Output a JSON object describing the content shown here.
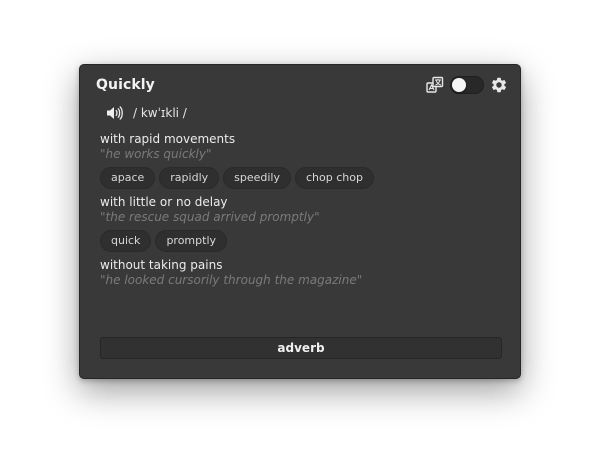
{
  "window": {
    "title": "Quickly"
  },
  "pronunciation": "/ kwˈɪkli /",
  "senses": [
    {
      "definition": "with rapid movements",
      "example": "\"he works quickly\"",
      "synonyms": [
        "apace",
        "rapidly",
        "speedily",
        "chop chop"
      ]
    },
    {
      "definition": "with little or no delay",
      "example": "\"the rescue squad arrived promptly\"",
      "synonyms": [
        "quick",
        "promptly"
      ]
    },
    {
      "definition": "without taking pains",
      "example": "\"he looked cursorily through the magazine\"",
      "synonyms": []
    }
  ],
  "part_of_speech": "adverb",
  "toggle": {
    "on": false
  },
  "icons": {
    "translate": "translate-icon",
    "toggle": "toggle-switch",
    "settings": "gear-icon",
    "speaker": "speaker-icon"
  },
  "colors": {
    "window_bg": "#393939",
    "text": "#ececec",
    "example_text": "#7a7a7a",
    "chip_bg": "#2f2f2f"
  }
}
